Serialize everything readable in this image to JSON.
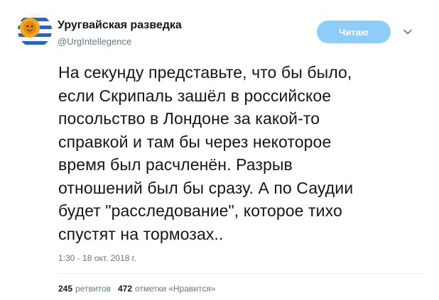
{
  "user": {
    "name": "Уругвайская разведка",
    "handle": "@UrgIntellegence",
    "avatar_icon": "uruguay-flag-sun-avatar"
  },
  "follow_button": {
    "label": "Читаю",
    "color": "#8ecdf8"
  },
  "menu": {
    "icon": "chevron-down-icon"
  },
  "tweet": {
    "text": "На секунду представьте, что бы было,\nесли Скрипаль зашёл в российское\nпосольство в Лондоне за какой-то\nсправкой и там бы через некоторое\nвремя был расчленён. Разрыв\nотношений был бы сразу. А по Саудии\nбудет \"расследование\", которое тихо\nспустят на тормозах..",
    "timestamp": "1:30 - 18 окт. 2018 г."
  },
  "stats": {
    "retweets_count": "245",
    "retweets_label": "ретвитов",
    "likes_count": "472",
    "likes_label": "отметки «Нравится»"
  }
}
